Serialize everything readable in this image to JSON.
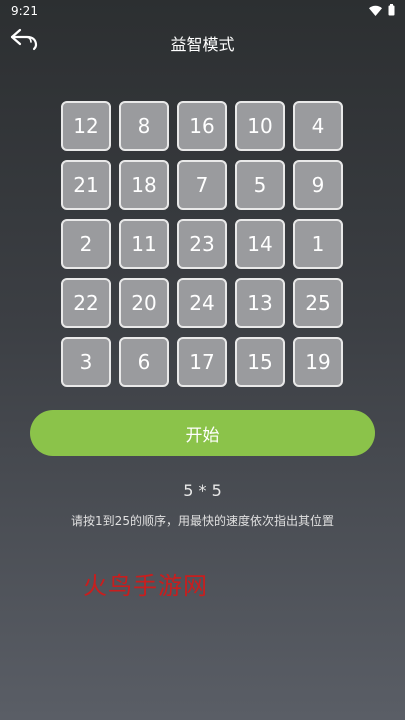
{
  "status_bar": {
    "time": "9:21"
  },
  "header": {
    "title": "益智模式"
  },
  "grid": {
    "size_label": "5 * 5",
    "numbers": [
      "12",
      "8",
      "16",
      "10",
      "4",
      "21",
      "18",
      "7",
      "5",
      "9",
      "2",
      "11",
      "23",
      "14",
      "1",
      "22",
      "20",
      "24",
      "13",
      "25",
      "3",
      "6",
      "17",
      "15",
      "19"
    ]
  },
  "start_label": "开始",
  "instruction": "请按1到25的顺序，用最快的速度依次指出其位置",
  "watermark": "火鸟手游网",
  "colors": {
    "accent": "#8bc34a",
    "cell_fill": "#9a9b9e",
    "cell_border": "#e9e9e9",
    "watermark": "#c81e1e"
  }
}
